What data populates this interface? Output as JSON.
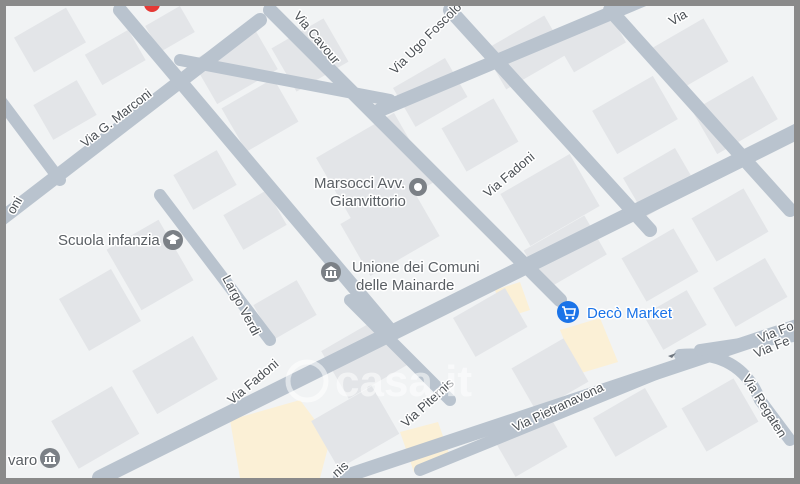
{
  "map": {
    "colors": {
      "background": "#f1f3f4",
      "building": "#e3e5e8",
      "road": "#b9c3ce",
      "highlight_area": "#fbf0d6",
      "poi_gray": "#7b8086",
      "poi_blue": "#1a73e8",
      "frame": "#8a8a8a"
    },
    "streets": {
      "via_cavour": "Via Cavour",
      "via_ugo_foscolo": "Via Ugo Foscolo",
      "via_g_marconi": "Via G. Marconi",
      "via_fadoni_upper": "Via Fadoni",
      "via_fadoni_lower": "Via Fadoni",
      "largo_verdi": "Largo Verdi",
      "via_pietranavona": "Via Pietranavona",
      "via_piternis": "Via Piternis",
      "via_piternis_bottom": "nis",
      "via_regate": "Via Regaten",
      "via_fo": "Via Fo",
      "via_fe": "Via Fe",
      "via_left": "oni",
      "via_top_right": "Via",
      "place_left_bottom": "varo"
    },
    "pois": {
      "marsocci_line1": "Marsocci Avv.",
      "marsocci_line2": "Gianvittorio",
      "marsocci_icon": "location-pin-icon",
      "scuola": "Scuola infanzia",
      "scuola_icon": "school-icon",
      "unione_line1": "Unione dei Comuni",
      "unione_line2": "delle Mainarde",
      "unione_icon": "government-building-icon",
      "deco": "Decò Market",
      "deco_icon": "shopping-cart-icon",
      "varo_icon": "government-building-icon"
    },
    "watermark": "casa.it"
  }
}
